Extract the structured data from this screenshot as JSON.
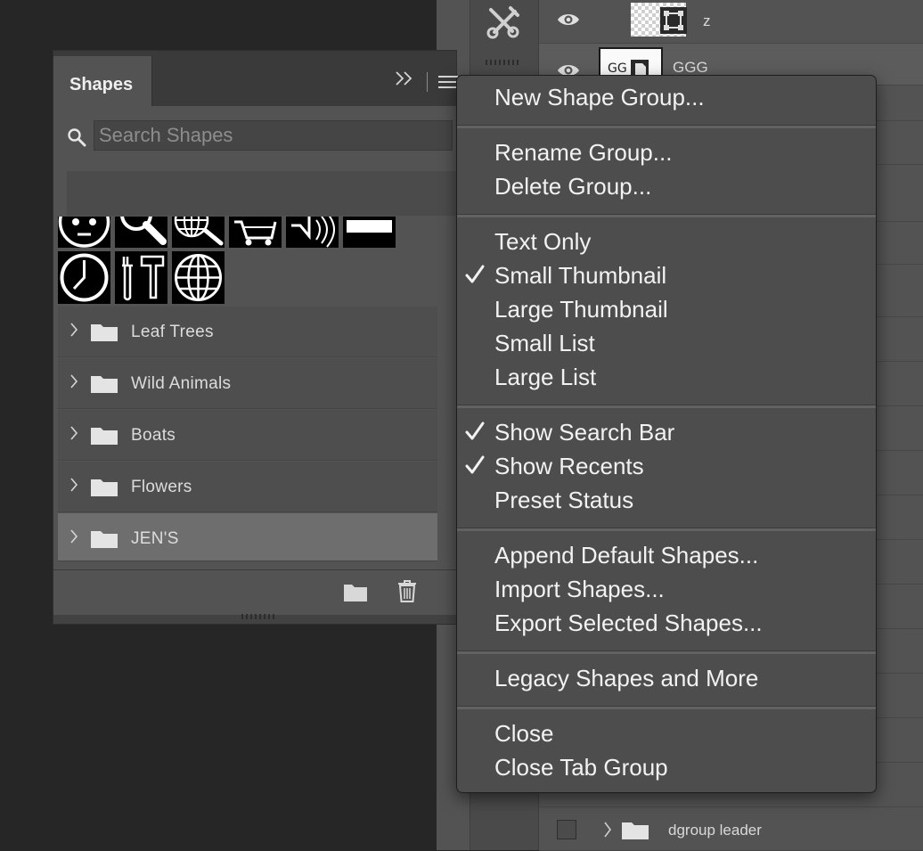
{
  "layers": {
    "rows": [
      {
        "name": "z"
      },
      {
        "name": "GGG"
      },
      {
        "name": "dgroup leader"
      }
    ]
  },
  "shapes_panel": {
    "tab_label": "Shapes",
    "collapse_glyph": "»",
    "search_placeholder": "Search Shapes",
    "groups": [
      {
        "label": "Leaf Trees"
      },
      {
        "label": "Wild Animals"
      },
      {
        "label": "Boats"
      },
      {
        "label": "Flowers"
      },
      {
        "label": "JEN'S",
        "selected": true
      }
    ],
    "icons": [
      "face-shape-icon",
      "magnifier-shape-icon",
      "globe-search-shape-icon",
      "cart-shape-icon",
      "speaker-shape-icon",
      "bar-shape-icon",
      "clock-shape-icon",
      "tools-shape-icon",
      "globe-shape-icon"
    ]
  },
  "context_menu": {
    "items": [
      {
        "label": "New Shape Group...",
        "checked": false
      },
      {
        "label": "Rename Group...",
        "checked": false
      },
      {
        "label": "Delete Group...",
        "checked": false
      },
      {
        "label": "Text Only",
        "checked": false
      },
      {
        "label": "Small Thumbnail",
        "checked": true
      },
      {
        "label": "Large Thumbnail",
        "checked": false
      },
      {
        "label": "Small List",
        "checked": false
      },
      {
        "label": "Large List",
        "checked": false
      },
      {
        "label": "Show Search Bar",
        "checked": true
      },
      {
        "label": "Show Recents",
        "checked": true
      },
      {
        "label": "Preset Status",
        "checked": false
      },
      {
        "label": "Append Default Shapes...",
        "checked": false
      },
      {
        "label": "Import Shapes...",
        "checked": false
      },
      {
        "label": "Export Selected Shapes...",
        "checked": false
      },
      {
        "label": "Legacy Shapes and More",
        "checked": false
      },
      {
        "label": "Close",
        "checked": false
      },
      {
        "label": "Close Tab Group",
        "checked": false
      }
    ]
  },
  "colors": {
    "app_background": "#262626",
    "panel_background": "#535353",
    "menu_background": "#4d4d4d",
    "selected_row": "#6e6e6e",
    "text": "#f2f2f2"
  }
}
